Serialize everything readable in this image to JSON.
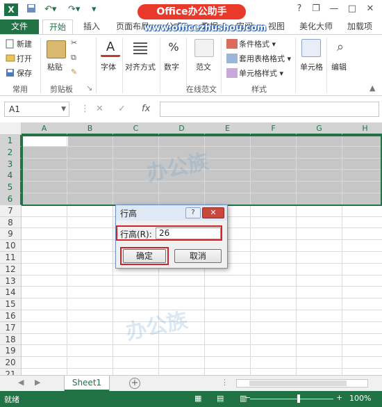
{
  "titlebar": {
    "app_icon": "excel-icon",
    "banner_text": "Office办公助手",
    "watermark_url": "www.officezhushou.com",
    "help_glyph": "?",
    "restore_glyph": "❐",
    "minimize_glyph": "—",
    "maximize_glyph": "□",
    "close_glyph": "✕"
  },
  "tabs": [
    "文件",
    "开始",
    "插入",
    "页面布局",
    "公式",
    "数据",
    "审阅",
    "视图",
    "美化大师",
    "加载项"
  ],
  "active_tab": "开始",
  "ribbon": {
    "clipboard": {
      "new": "新建",
      "open": "打开",
      "save": "保存",
      "paste": "粘贴",
      "group": "常用",
      "group2": "剪贴板"
    },
    "font": {
      "label": "字体"
    },
    "alignment": {
      "label": "对齐方式"
    },
    "number": {
      "label": "数字",
      "symbol": "%"
    },
    "template": {
      "label": "范文",
      "group": "在线范文"
    },
    "styles": {
      "conditional": "条件格式",
      "table": "套用表格格式",
      "cell": "单元格样式",
      "group": "样式"
    },
    "cells": {
      "label": "单元格"
    },
    "editing": {
      "label": "编辑"
    }
  },
  "formula_bar": {
    "name_box": "A1",
    "cancel": "✕",
    "enter": "✓",
    "fx": "fx",
    "value": ""
  },
  "grid": {
    "columns": [
      "A",
      "B",
      "C",
      "D",
      "E",
      "F",
      "G",
      "H"
    ],
    "rows": [
      "1",
      "2",
      "3",
      "4",
      "5",
      "6",
      "7",
      "8",
      "9",
      "10",
      "11",
      "12",
      "13",
      "14",
      "15",
      "16",
      "17",
      "18",
      "19",
      "20",
      "21"
    ],
    "selected_rows": 6
  },
  "dialog": {
    "title": "行高",
    "help": "?",
    "close": "✕",
    "field_label": "行高(R):",
    "field_value": "26",
    "ok": "确定",
    "cancel": "取消"
  },
  "sheet_tabs": {
    "active": "Sheet1",
    "add": "+"
  },
  "status": {
    "ready": "就绪",
    "zoom": "100%",
    "zoom_minus": "−",
    "zoom_plus": "+"
  },
  "colors": {
    "excel_green": "#217346",
    "highlight_red": "#d0242a",
    "banner_red": "#e8392b"
  }
}
